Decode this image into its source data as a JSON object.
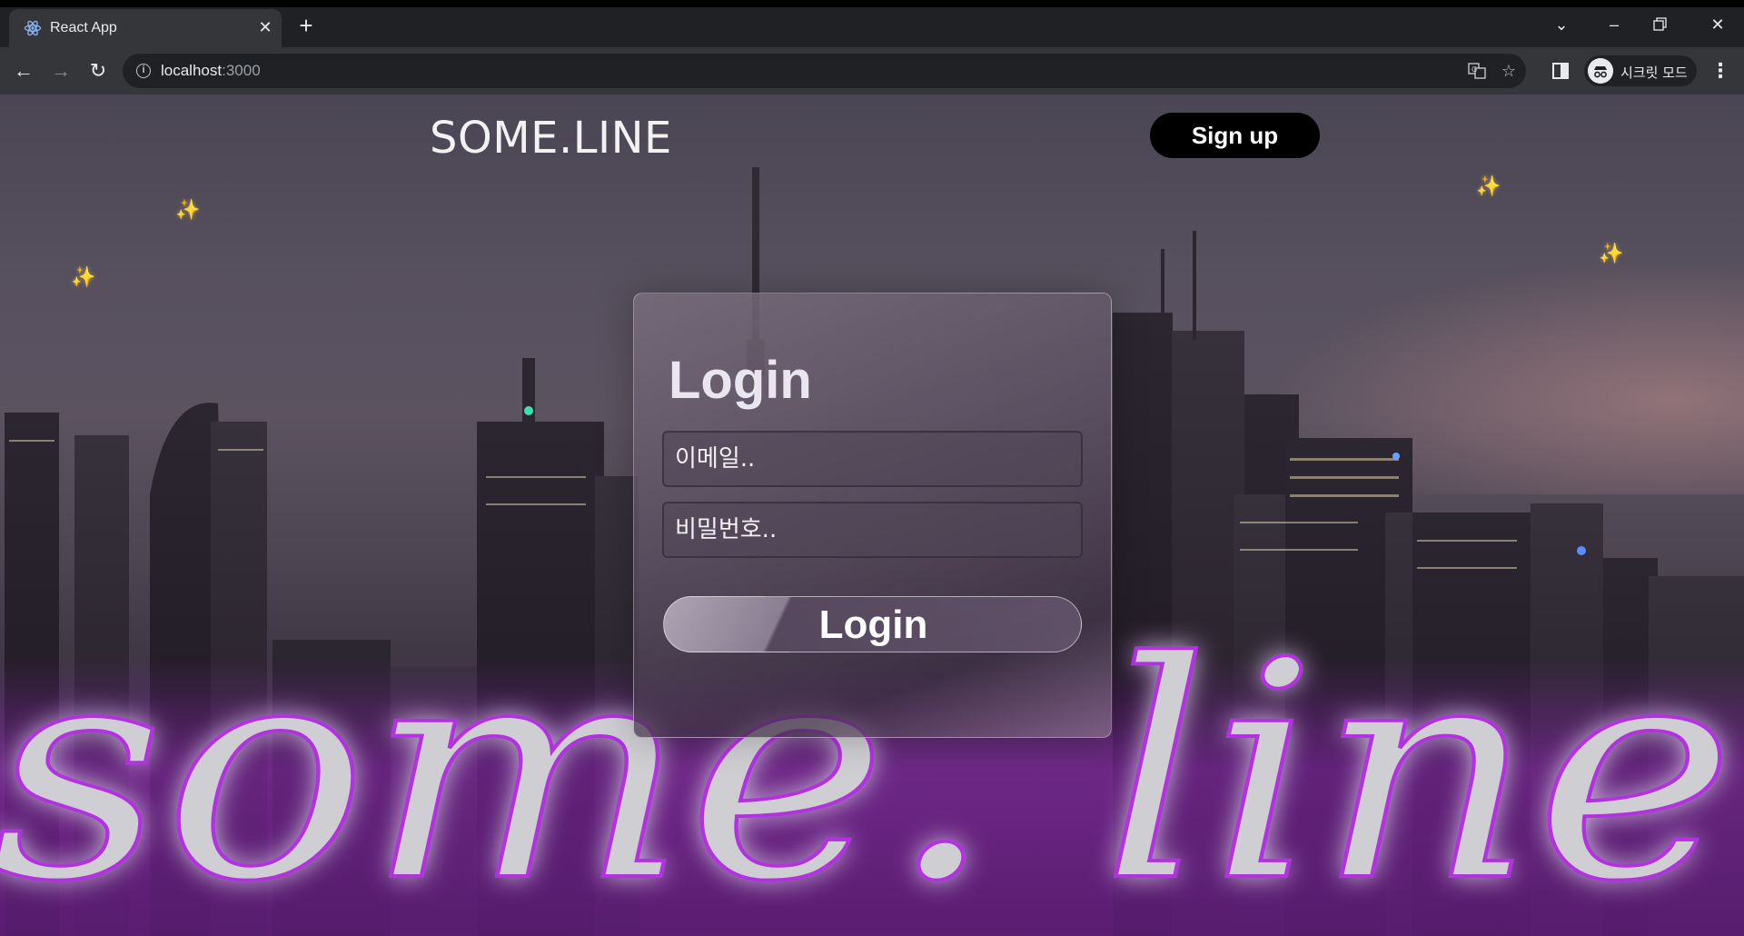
{
  "browser": {
    "tab_title": "React App",
    "url_host": "localhost",
    "url_port": ":3000",
    "profile_label": "시크릿 모드"
  },
  "page": {
    "brand": "SOME.LINE",
    "signup_label": "Sign up",
    "background_neon_text": "some. line",
    "sparkle": "✨",
    "login": {
      "title": "Login",
      "email_placeholder": "이메일..",
      "password_placeholder": "비밀번호..",
      "button_label": "Login"
    }
  },
  "colors": {
    "chrome_dark": "#202124",
    "chrome_toolbar": "#35363a",
    "neon_purple": "#b230e0",
    "neon_text": "#cfcfd3",
    "signup_bg": "#000000"
  }
}
